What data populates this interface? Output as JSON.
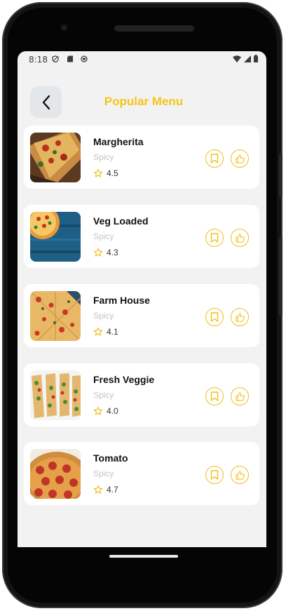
{
  "status_bar": {
    "time": "8:18"
  },
  "header": {
    "title": "Popular Menu"
  },
  "items": [
    {
      "name": "Margherita",
      "tag": "Spicy",
      "rating": "4.5"
    },
    {
      "name": "Veg Loaded",
      "tag": "Spicy",
      "rating": "4.3"
    },
    {
      "name": "Farm House",
      "tag": "Spicy",
      "rating": "4.1"
    },
    {
      "name": "Fresh Veggie",
      "tag": "Spicy",
      "rating": "4.0"
    },
    {
      "name": "Tomato",
      "tag": "Spicy",
      "rating": "4.7"
    }
  ],
  "colors": {
    "accent": "#f5c518",
    "background": "#f2f2f2",
    "card": "#ffffff",
    "back_button_bg": "#e3e7ea"
  },
  "icons": {
    "back": "chevron-left-icon",
    "rating": "star-outline-icon",
    "bookmark": "bookmark-icon",
    "like": "thumbs-up-icon"
  }
}
